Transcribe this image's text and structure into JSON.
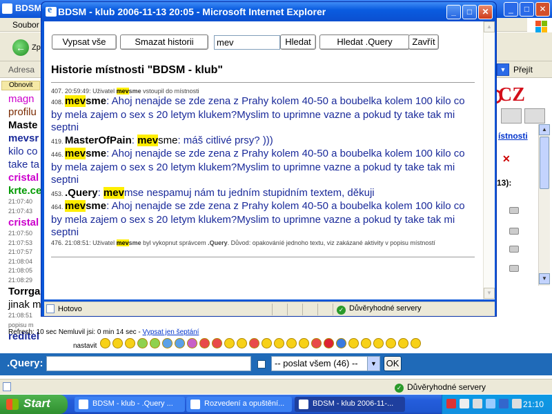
{
  "background_window": {
    "title": "BDSM",
    "menu_first": "Soubor",
    "back_label": "Zp",
    "address_label": "Adresa",
    "go_label": "Přejít",
    "status_trusted": "Důvěryhodné servery",
    "left_chat": {
      "refresh_button": "Obnovit",
      "lines": [
        {
          "text": "magn",
          "color": "#cc00cc"
        },
        {
          "text": "profilu",
          "color": "#7a2a00"
        },
        {
          "text": "Maste",
          "color": "#000000",
          "bold": true
        },
        {
          "text": "mevsr",
          "color": "#1a2a9a",
          "bold": true
        },
        {
          "text": "kilo co",
          "color": "#1a2a9a"
        },
        {
          "text": "take ta",
          "color": "#1a2a9a"
        },
        {
          "text": "cristal",
          "color": "#cc00cc",
          "bold": true
        },
        {
          "text": "krte.ce",
          "color": "#009900",
          "bold": true
        },
        {
          "text": "21:07:40",
          "small": true
        },
        {
          "text": "21:07:43",
          "small": true
        },
        {
          "text": "cristal",
          "color": "#cc00cc",
          "bold": true
        },
        {
          "text": "21:07:50",
          "small": true
        },
        {
          "text": "21:07:53",
          "small": true
        },
        {
          "text": "21:07:57",
          "small": true
        },
        {
          "text": "21:08:04",
          "small": true
        },
        {
          "text": "21:08:05",
          "small": true
        },
        {
          "text": "21:08:29",
          "small": true
        },
        {
          "text": "Torrga",
          "color": "#000000",
          "bold": true
        },
        {
          "text": "jinak m",
          "color": "#000000"
        },
        {
          "text": "21:08:51",
          "small": true
        },
        {
          "text": "popisu m",
          "small": true
        },
        {
          "text": "reditel",
          "color": "#1a2a9a",
          "bold": true
        }
      ]
    },
    "right_column": {
      "logo": "CZ",
      "rooms_link": "ístnosti",
      "count_label": "13):"
    },
    "refresh_info": "Refresh: 10 sec     Nemluvil jsi: 0 min 14 sec - ",
    "whisper_link": "Vypsat jen šeptání",
    "settings_label": "nastavit",
    "query_label": ".Query:",
    "send_select": "-- poslat všem (46) --",
    "ok_button": "OK"
  },
  "popup": {
    "title": "BDSM - klub 2006-11-13 20:05 - Microsoft Internet Explorer",
    "buttons": {
      "list_all": "Vypsat vše",
      "clear_history": "Smazat historii",
      "search": "Hledat",
      "search_query": "Hledat .Query",
      "close": "Zavřít"
    },
    "search_value": "mev",
    "heading": "Historie místnosti \"BDSM - klub\"",
    "entries": [
      {
        "type": "sys",
        "num": "407.",
        "pre": "20:59:49: Uživatel ",
        "hl": "mev",
        "post": "sme",
        "rest": " vstoupil do místnosti"
      },
      {
        "type": "msg",
        "num": "408.",
        "hl": "mev",
        "nick": "sme",
        "text": ": Ahoj nenajde se zde zena z Prahy kolem 40-50 a boubelka kolem 100 kilo co by mela zajem o sex s 20 letym klukem?Myslim to uprimne vazne a pokud ty take tak mi septni"
      },
      {
        "type": "msg2",
        "num": "419.",
        "nick1": "MasterOfPain",
        "sep": ": ",
        "hl": "mev",
        "nick2": "sme",
        "text": ": máš citlivé prsy? )))"
      },
      {
        "type": "msg",
        "num": "446.",
        "hl": "mev",
        "nick": "sme",
        "text": ": Ahoj nenajde se zde zena z Prahy kolem 40-50 a boubelka kolem 100 kilo co by mela zajem o sex s 20 letym klukem?Myslim to uprimne vazne a pokud ty take tak mi septni"
      },
      {
        "type": "msg3",
        "num": "453.",
        "nick": ".Query",
        "sep": ": ",
        "hl": "mev",
        "text": "mse nespamuj nám tu jedním stupidním textem, děkuji"
      },
      {
        "type": "msg",
        "num": "464.",
        "hl": "mev",
        "nick": "sme",
        "text": ": Ahoj nenajde se zde zena z Prahy kolem 40-50 a boubelka kolem 100 kilo co by mela zajem o sex s 20 letym klukem?Myslim to uprimne vazne a pokud ty take tak mi septni"
      },
      {
        "type": "sys2",
        "num": "476.",
        "pre": "21:08:51: Uživatel ",
        "hl": "mev",
        "post": "sme",
        "mid": " byl vykopnut správcem ",
        "admin": ".Query",
        "rest": ". Důvod: opakováníé jednoho textu, viz zakázané aktivity v popisu místností"
      }
    ],
    "status_done": "Hotovo",
    "status_trusted": "Důvěryhodné servery"
  },
  "taskbar": {
    "start": "Start",
    "tasks": [
      {
        "label": "BDSM - klub - .Query ...",
        "active": false
      },
      {
        "label": "Rozvedení a opuštění...",
        "active": false
      },
      {
        "label": "BDSM - klub 2006-11-...",
        "active": true
      }
    ],
    "clock": "21:10"
  }
}
